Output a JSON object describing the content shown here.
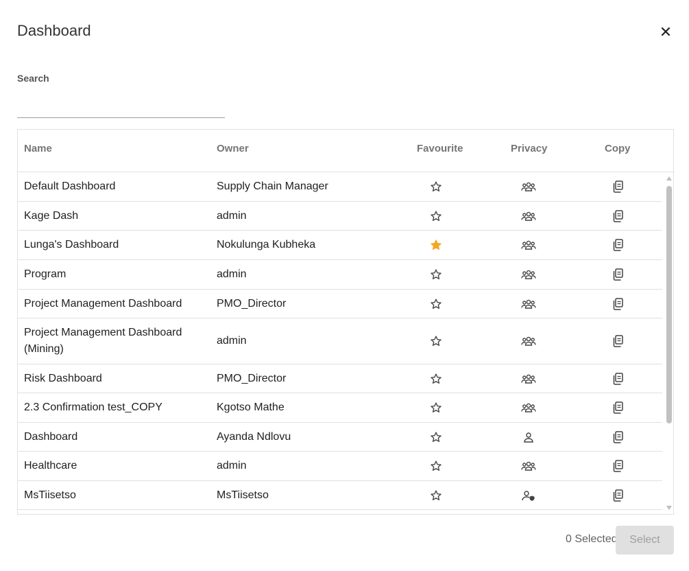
{
  "dialog": {
    "title": "Dashboard",
    "close_icon": "close-icon"
  },
  "search": {
    "label": "Search",
    "value": "",
    "placeholder": ""
  },
  "table": {
    "columns": [
      "Name",
      "Owner",
      "Favourite",
      "Privacy",
      "Copy"
    ],
    "rows": [
      {
        "name": "Default Dashboard",
        "owner": "Supply Chain Manager",
        "favourite": false,
        "privacy": "group"
      },
      {
        "name": "Kage Dash",
        "owner": "admin",
        "favourite": false,
        "privacy": "group"
      },
      {
        "name": "Lunga's Dashboard",
        "owner": "Nokulunga Kubheka",
        "favourite": true,
        "privacy": "group"
      },
      {
        "name": "Program",
        "owner": "admin",
        "favourite": false,
        "privacy": "group"
      },
      {
        "name": "Project Management Dashboard",
        "owner": "PMO_Director",
        "favourite": false,
        "privacy": "group"
      },
      {
        "name": "Project Management Dashboard (Mining)",
        "owner": "admin",
        "favourite": false,
        "privacy": "group"
      },
      {
        "name": "Risk Dashboard",
        "owner": "PMO_Director",
        "favourite": false,
        "privacy": "group"
      },
      {
        "name": "2.3 Confirmation test_COPY",
        "owner": "Kgotso Mathe",
        "favourite": false,
        "privacy": "group"
      },
      {
        "name": "Dashboard",
        "owner": "Ayanda Ndlovu",
        "favourite": false,
        "privacy": "private"
      },
      {
        "name": "Healthcare",
        "owner": "admin",
        "favourite": false,
        "privacy": "group"
      },
      {
        "name": "MsTiisetso",
        "owner": "MsTiisetso",
        "favourite": false,
        "privacy": "restricted"
      }
    ]
  },
  "footer": {
    "selected_count": "0 Selected",
    "select_label": "Select"
  },
  "colors": {
    "favourite_active": "#f5a623",
    "icon": "#424242",
    "header_text": "#757575",
    "divider": "#e0e0e0",
    "button_disabled_bg": "#e0e0e0",
    "button_disabled_text": "#9e9e9e"
  }
}
